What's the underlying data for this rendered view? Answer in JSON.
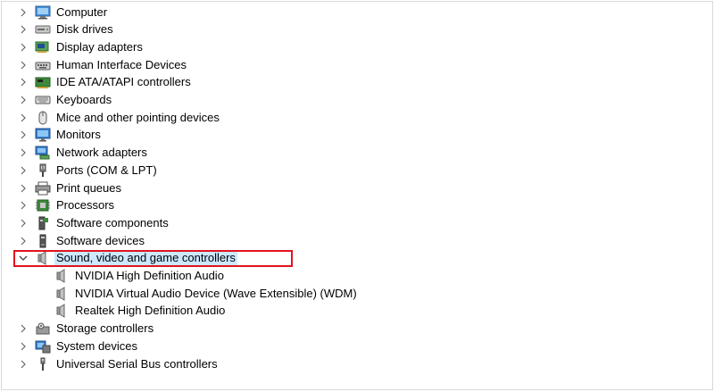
{
  "tree": {
    "categories": [
      {
        "label": "Computer",
        "icon": "computer-icon",
        "expanded": false
      },
      {
        "label": "Disk drives",
        "icon": "disk-drive-icon",
        "expanded": false
      },
      {
        "label": "Display adapters",
        "icon": "display-adapter-icon",
        "expanded": false
      },
      {
        "label": "Human Interface Devices",
        "icon": "hid-icon",
        "expanded": false
      },
      {
        "label": "IDE ATA/ATAPI controllers",
        "icon": "ide-controller-icon",
        "expanded": false
      },
      {
        "label": "Keyboards",
        "icon": "keyboard-icon",
        "expanded": false
      },
      {
        "label": "Mice and other pointing devices",
        "icon": "mouse-icon",
        "expanded": false
      },
      {
        "label": "Monitors",
        "icon": "monitor-icon",
        "expanded": false
      },
      {
        "label": "Network adapters",
        "icon": "network-adapter-icon",
        "expanded": false
      },
      {
        "label": "Ports (COM & LPT)",
        "icon": "port-icon",
        "expanded": false
      },
      {
        "label": "Print queues",
        "icon": "printer-icon",
        "expanded": false
      },
      {
        "label": "Processors",
        "icon": "processor-icon",
        "expanded": false
      },
      {
        "label": "Software components",
        "icon": "software-component-icon",
        "expanded": false
      },
      {
        "label": "Software devices",
        "icon": "software-device-icon",
        "expanded": false
      },
      {
        "label": "Sound, video and game controllers",
        "icon": "speaker-icon",
        "expanded": true,
        "selected": true,
        "children": [
          {
            "label": "NVIDIA High Definition Audio",
            "icon": "speaker-icon"
          },
          {
            "label": "NVIDIA Virtual Audio Device (Wave Extensible) (WDM)",
            "icon": "speaker-icon"
          },
          {
            "label": "Realtek High Definition Audio",
            "icon": "speaker-icon"
          }
        ]
      },
      {
        "label": "Storage controllers",
        "icon": "storage-controller-icon",
        "expanded": false
      },
      {
        "label": "System devices",
        "icon": "system-device-icon",
        "expanded": false
      },
      {
        "label": "Universal Serial Bus controllers",
        "icon": "usb-icon",
        "expanded": false
      }
    ]
  },
  "colors": {
    "selection": "#cce8ff",
    "highlight_border": "#e0141e",
    "chevron": "#666666"
  }
}
